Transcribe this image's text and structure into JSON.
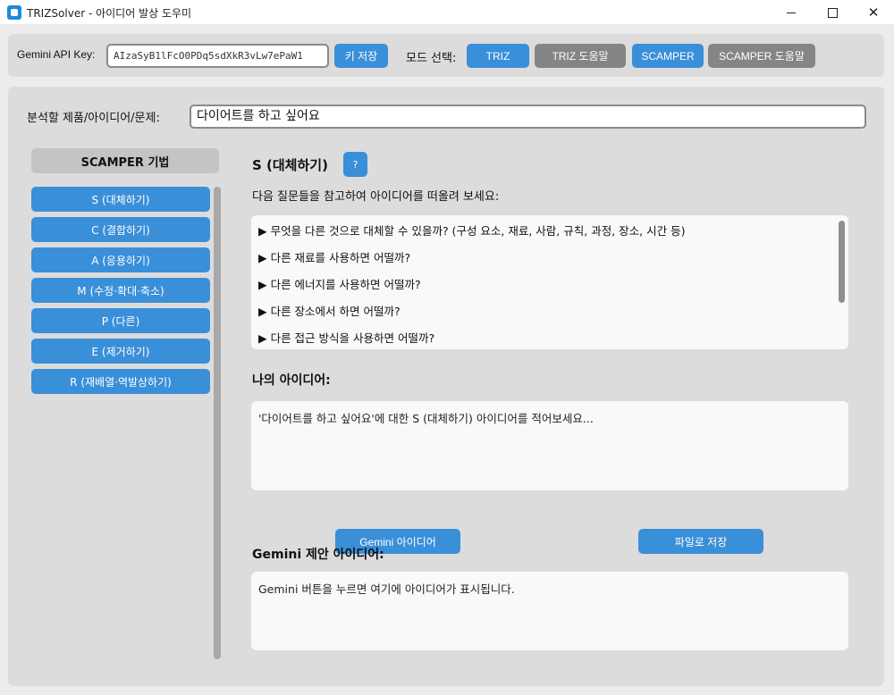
{
  "window": {
    "title": "TRIZSolver - 아이디어 발상 도우미",
    "minimize": "",
    "maximize": "",
    "close": "✕"
  },
  "toolbar": {
    "api_label": "Gemini API Key:",
    "api_value": "AIzaSyB1lFcO0PDq5sdXkR3vLw7ePaW1",
    "save_key": "키 저장",
    "mode_label": "모드 선택:",
    "modes": [
      "TRIZ",
      "TRIZ 도움말",
      "SCAMPER",
      "SCAMPER 도움말"
    ]
  },
  "problem": {
    "label": "분석할 제품/아이디어/문제:",
    "value": "다이어트를 하고 싶어요"
  },
  "sidebar": {
    "header": "SCAMPER 기법",
    "items": [
      "S (대체하기)",
      "C (결합하기)",
      "A (응용하기)",
      "M (수정·확대·축소)",
      "P (다른)",
      "E (제거하기)",
      "R (재배열·역발상하기)"
    ]
  },
  "technique": {
    "title": "S (대체하기)",
    "help": "?",
    "instruction": "다음 질문들을 참고하여 아이디어를 떠올려 보세요:",
    "questions": [
      "▶ 무엇을 다른 것으로 대체할 수 있을까? (구성 요소, 재료, 사람, 규칙, 과정, 장소, 시간 등)",
      "▶ 다른 재료를 사용하면 어떨까?",
      "▶ 다른 에너지를 사용하면 어떨까?",
      "▶ 다른 장소에서 하면 어떨까?",
      "▶ 다른 접근 방식을 사용하면 어떨까?"
    ]
  },
  "my_idea": {
    "label": "나의 아이디어:",
    "placeholder": "'다이어트를 하고 싶어요'에 대한 S (대체하기) 아이디어를 적어보세요..."
  },
  "actions": {
    "gemini": "Gemini 아이디어",
    "save_file": "파일로 저장"
  },
  "gemini": {
    "label": "Gemini 제안 아이디어:",
    "text": "Gemini 버튼을 누르면 여기에 아이디어가 표시됩니다."
  }
}
